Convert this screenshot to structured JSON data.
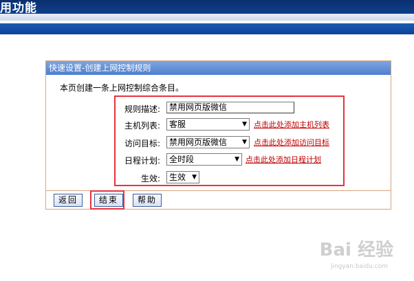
{
  "banner": {
    "title": "用功能"
  },
  "panel": {
    "header": "快速设置-创建上网控制规则",
    "intro": "本页创建一条上网控制综合条目。"
  },
  "form": {
    "rule_desc_label": "规则描述:",
    "rule_desc_value": "禁用网页版微信",
    "host_list_label": "主机列表:",
    "host_list_value": "客服",
    "host_list_link": "点击此处添加主机列表",
    "target_label": "访问目标:",
    "target_value": "禁用网页版微信",
    "target_link": "点击此处添加访问目标",
    "schedule_label": "日程计划:",
    "schedule_value": "全时段",
    "schedule_link": "点击此处添加日程计划",
    "effect_label": "生效:",
    "effect_value": "生效"
  },
  "buttons": {
    "back": "返回",
    "finish": "结束",
    "help": "帮助"
  },
  "watermark": {
    "brand": "Bai 经验",
    "url": "jingyan.baidu.com"
  },
  "colors": {
    "banner": "#0f4ea6",
    "header": "#4d7fcf",
    "highlight": "#e8323c",
    "link": "#c00000"
  }
}
